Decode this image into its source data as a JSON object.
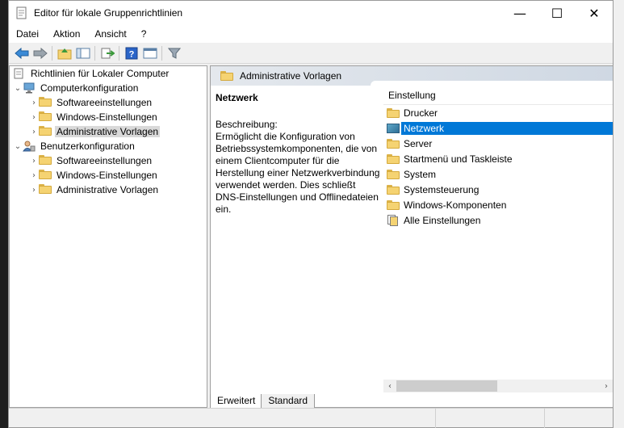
{
  "window": {
    "title": "Editor für lokale Gruppenrichtlinien",
    "controls": [
      "—",
      "☐",
      "✕"
    ]
  },
  "menu": [
    "Datei",
    "Aktion",
    "Ansicht",
    "?"
  ],
  "tree": {
    "root": "Richtlinien für Lokaler Computer",
    "computer": {
      "label": "Computerkonfiguration",
      "children": [
        "Softwareeinstellungen",
        "Windows-Einstellungen",
        "Administrative Vorlagen"
      ]
    },
    "user": {
      "label": "Benutzerkonfiguration",
      "children": [
        "Softwareeinstellungen",
        "Windows-Einstellungen",
        "Administrative Vorlagen"
      ]
    }
  },
  "right": {
    "header": "Administrative Vorlagen",
    "selected_title": "Netzwerk",
    "desc_label": "Beschreibung:",
    "desc_text": "Ermöglicht die Konfiguration von Betriebssystemkomponenten, die von einem Clientcomputer für die Herstellung einer Netzwerkverbindung verwendet werden. Dies schließt DNS-Einstellungen und Offlinedateien ein.",
    "column": "Einstellung",
    "items": [
      "Drucker",
      "Netzwerk",
      "Server",
      "Startmenü und Taskleiste",
      "System",
      "Systemsteuerung",
      "Windows-Komponenten",
      "Alle Einstellungen"
    ]
  },
  "tabs": [
    "Erweitert",
    "Standard"
  ]
}
